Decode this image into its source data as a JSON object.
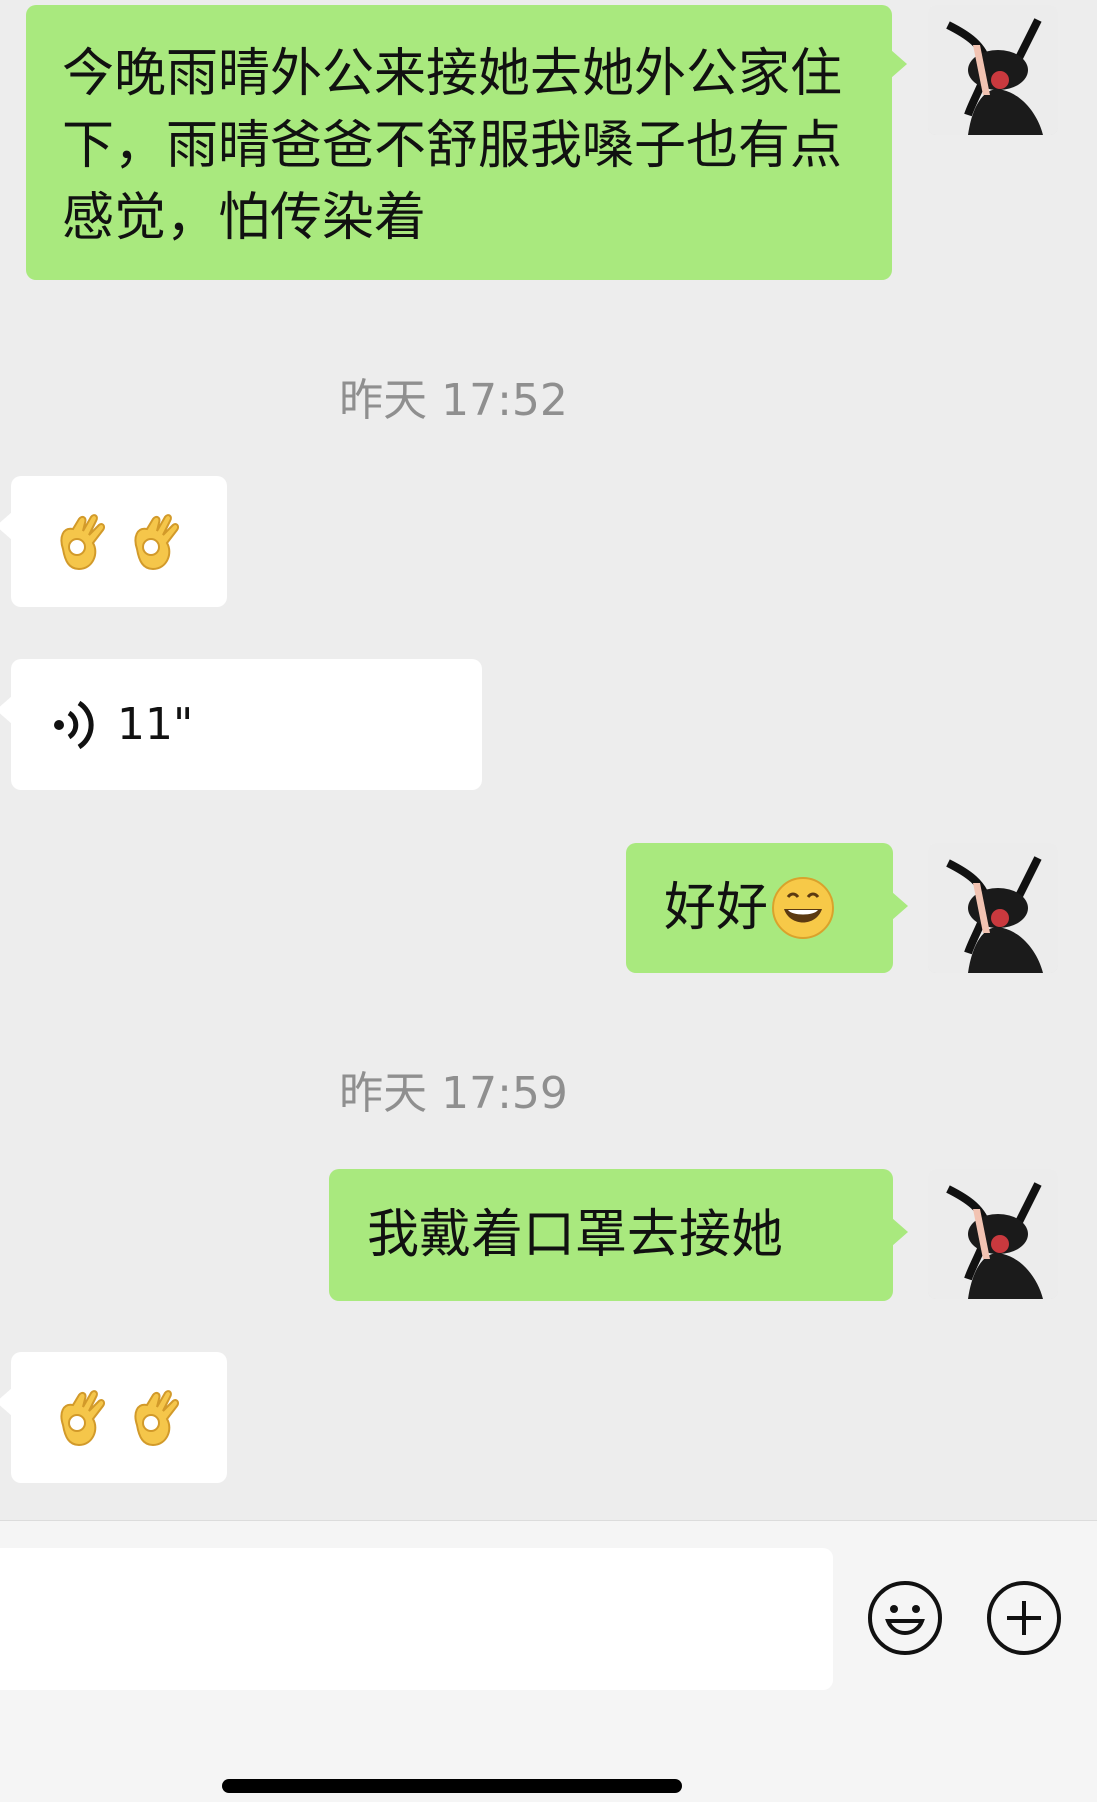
{
  "conversation": {
    "messages": [
      {
        "type": "text",
        "side": "me",
        "text": "今晚雨晴外公来接她去她外公家住下，雨晴爸爸不舒服我嗓子也有点感觉，怕传染着"
      },
      {
        "type": "timestamp",
        "text": "昨天 17:52"
      },
      {
        "type": "emoji",
        "side": "them",
        "emoji_name": "ok-hand-icon"
      },
      {
        "type": "voice",
        "side": "them",
        "duration": "11\""
      },
      {
        "type": "text",
        "side": "me",
        "text": "好好",
        "emoji_name": "grinning-face-icon"
      },
      {
        "type": "timestamp",
        "text": "昨天 17:59"
      },
      {
        "type": "text",
        "side": "me",
        "text": "我戴着口罩去接她"
      },
      {
        "type": "emoji",
        "side": "them",
        "emoji_name": "ok-hand-icon"
      }
    ]
  },
  "colors": {
    "background": "#ededed",
    "my_bubble": "#a9e97e",
    "their_bubble": "#ffffff",
    "timestamp_text": "#8f8f8f"
  },
  "input_bar": {
    "input_value": "",
    "emoji_button_icon": "smiley-face-icon",
    "more_button_icon": "plus-circle-icon"
  }
}
